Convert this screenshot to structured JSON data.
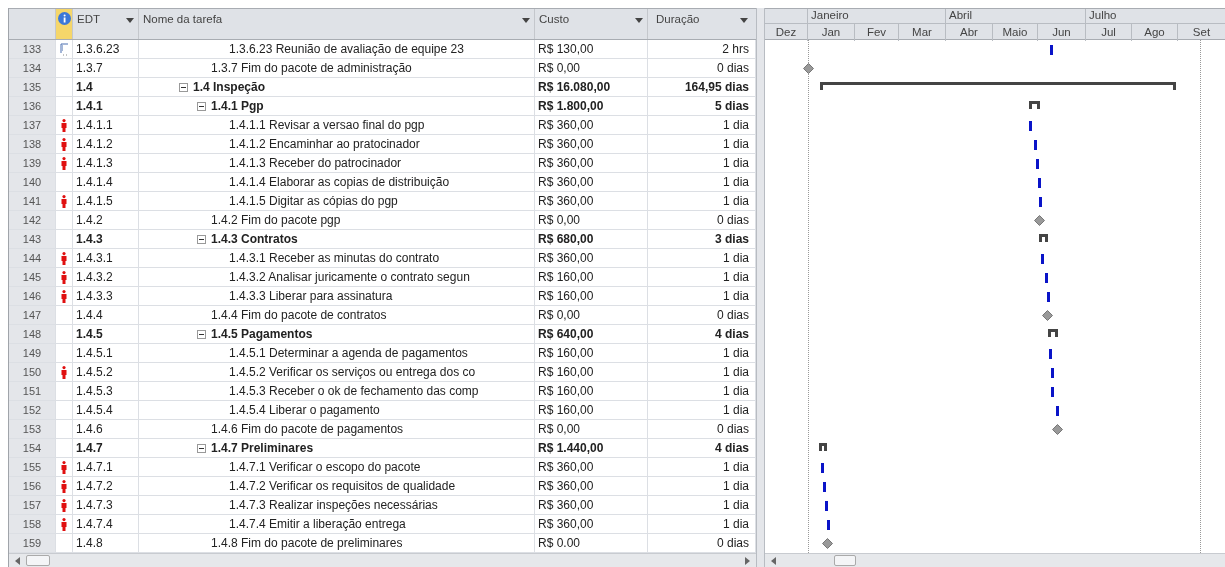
{
  "columns": {
    "edt": "EDT",
    "name": "Nome da tarefa",
    "cost": "Custo",
    "duration": "Duração"
  },
  "timescale": {
    "top": [
      "Janeiro",
      "Abril",
      "Julho"
    ],
    "bottom": [
      "Dez",
      "Jan",
      "Fev",
      "Mar",
      "Abr",
      "Maio",
      "Jun",
      "Jul",
      "Ago",
      "Set"
    ]
  },
  "rows": [
    {
      "id": "133",
      "kind": "task",
      "note": true,
      "resource": false,
      "edt": "1.3.6.23",
      "name": "1.3.6.23 Reunião de avaliação de equipe 23",
      "cost": "R$ 130,00",
      "duration": "2 hrs"
    },
    {
      "id": "134",
      "kind": "milestone",
      "note": false,
      "resource": false,
      "edt": "1.3.7",
      "name": "1.3.7 Fim do pacote de administração",
      "cost": "R$ 0,00",
      "duration": "0 dias"
    },
    {
      "id": "135",
      "kind": "summary",
      "note": false,
      "resource": false,
      "edt": "1.4",
      "name": "1.4 Inspeção",
      "cost": "R$ 16.080,00",
      "duration": "164,95 dias",
      "expanded": true,
      "children": [
        {
          "id": "136",
          "kind": "summary",
          "note": false,
          "resource": false,
          "edt": "1.4.1",
          "name": "1.4.1 Pgp",
          "cost": "R$ 1.800,00",
          "duration": "5 dias",
          "expanded": true,
          "children": [
            {
              "id": "137",
              "kind": "task",
              "note": false,
              "resource": true,
              "edt": "1.4.1.1",
              "name": "1.4.1.1 Revisar a versao final do pgp",
              "cost": "R$ 360,00",
              "duration": "1 dia"
            },
            {
              "id": "138",
              "kind": "task",
              "note": false,
              "resource": true,
              "edt": "1.4.1.2",
              "name": "1.4.1.2 Encaminhar ao pratocinador",
              "cost": "R$ 360,00",
              "duration": "1 dia"
            },
            {
              "id": "139",
              "kind": "task",
              "note": false,
              "resource": true,
              "edt": "1.4.1.3",
              "name": "1.4.1.3 Receber do patrocinador",
              "cost": "R$ 360,00",
              "duration": "1 dia"
            },
            {
              "id": "140",
              "kind": "task",
              "note": false,
              "resource": false,
              "edt": "1.4.1.4",
              "name": "1.4.1.4 Elaborar as copias de distribuição",
              "cost": "R$ 360,00",
              "duration": "1 dia"
            },
            {
              "id": "141",
              "kind": "task",
              "note": false,
              "resource": true,
              "edt": "1.4.1.5",
              "name": "1.4.1.5 Digitar as cópias do pgp",
              "cost": "R$ 360,00",
              "duration": "1 dia"
            }
          ]
        },
        {
          "id": "142",
          "kind": "milestone",
          "note": false,
          "resource": false,
          "edt": "1.4.2",
          "name": "1.4.2 Fim do pacote pgp",
          "cost": "R$ 0,00",
          "duration": "0 dias"
        },
        {
          "id": "143",
          "kind": "summary",
          "note": false,
          "resource": false,
          "edt": "1.4.3",
          "name": "1.4.3 Contratos",
          "cost": "R$ 680,00",
          "duration": "3 dias",
          "expanded": true,
          "children": [
            {
              "id": "144",
              "kind": "task",
              "note": false,
              "resource": true,
              "edt": "1.4.3.1",
              "name": "1.4.3.1 Receber as minutas do contrato",
              "cost": "R$ 360,00",
              "duration": "1 dia"
            },
            {
              "id": "145",
              "kind": "task",
              "note": false,
              "resource": true,
              "edt": "1.4.3.2",
              "name": "1.4.3.2 Analisar juricamente o contrato segun",
              "cost": "R$ 160,00",
              "duration": "1 dia"
            },
            {
              "id": "146",
              "kind": "task",
              "note": false,
              "resource": true,
              "edt": "1.4.3.3",
              "name": "1.4.3.3 Liberar para assinatura",
              "cost": "R$ 160,00",
              "duration": "1 dia"
            }
          ]
        },
        {
          "id": "147",
          "kind": "milestone",
          "note": false,
          "resource": false,
          "edt": "1.4.4",
          "name": "1.4.4 Fim do pacote de contratos",
          "cost": "R$ 0,00",
          "duration": "0 dias"
        },
        {
          "id": "148",
          "kind": "summary",
          "note": false,
          "resource": false,
          "edt": "1.4.5",
          "name": "1.4.5 Pagamentos",
          "cost": "R$ 640,00",
          "duration": "4 dias",
          "expanded": true,
          "children": [
            {
              "id": "149",
              "kind": "task",
              "note": false,
              "resource": false,
              "edt": "1.4.5.1",
              "name": "1.4.5.1 Determinar a agenda de pagamentos",
              "cost": "R$ 160,00",
              "duration": "1 dia"
            },
            {
              "id": "150",
              "kind": "task",
              "note": false,
              "resource": true,
              "edt": "1.4.5.2",
              "name": "1.4.5.2 Verificar os serviços ou entrega dos co",
              "cost": "R$ 160,00",
              "duration": "1 dia"
            },
            {
              "id": "151",
              "kind": "task",
              "note": false,
              "resource": false,
              "edt": "1.4.5.3",
              "name": "1.4.5.3 Receber o ok de fechamento das comp",
              "cost": "R$ 160,00",
              "duration": "1 dia"
            },
            {
              "id": "152",
              "kind": "task",
              "note": false,
              "resource": false,
              "edt": "1.4.5.4",
              "name": "1.4.5.4 Liberar o pagamento",
              "cost": "R$ 160,00",
              "duration": "1 dia"
            }
          ]
        },
        {
          "id": "153",
          "kind": "milestone",
          "note": false,
          "resource": false,
          "edt": "1.4.6",
          "name": "1.4.6 Fim do pacote de pagamentos",
          "cost": "R$ 0,00",
          "duration": "0 dias"
        },
        {
          "id": "154",
          "kind": "summary",
          "note": false,
          "resource": false,
          "edt": "1.4.7",
          "name": "1.4.7 Preliminares",
          "cost": "R$ 1.440,00",
          "duration": "4 dias",
          "expanded": true,
          "children": [
            {
              "id": "155",
              "kind": "task",
              "note": false,
              "resource": true,
              "edt": "1.4.7.1",
              "name": "1.4.7.1 Verificar o escopo do pacote",
              "cost": "R$ 360,00",
              "duration": "1 dia"
            },
            {
              "id": "156",
              "kind": "task",
              "note": false,
              "resource": true,
              "edt": "1.4.7.2",
              "name": "1.4.7.2 Verificar os requisitos de qualidade",
              "cost": "R$ 360,00",
              "duration": "1 dia"
            },
            {
              "id": "157",
              "kind": "task",
              "note": false,
              "resource": true,
              "edt": "1.4.7.3",
              "name": "1.4.7.3 Realizar inspeções necessárias",
              "cost": "R$ 360,00",
              "duration": "1 dia"
            },
            {
              "id": "158",
              "kind": "task",
              "note": false,
              "resource": true,
              "edt": "1.4.7.4",
              "name": "1.4.7.4 Emitir a liberação entrega",
              "cost": "R$ 360,00",
              "duration": "1 dia"
            }
          ]
        },
        {
          "id": "159",
          "kind": "milestone",
          "note": false,
          "resource": false,
          "edt": "1.4.8",
          "name": "1.4.8 Fim do pacote de preliminares",
          "cost": "R$ 0.00",
          "duration": "0 dias"
        }
      ]
    }
  ]
}
